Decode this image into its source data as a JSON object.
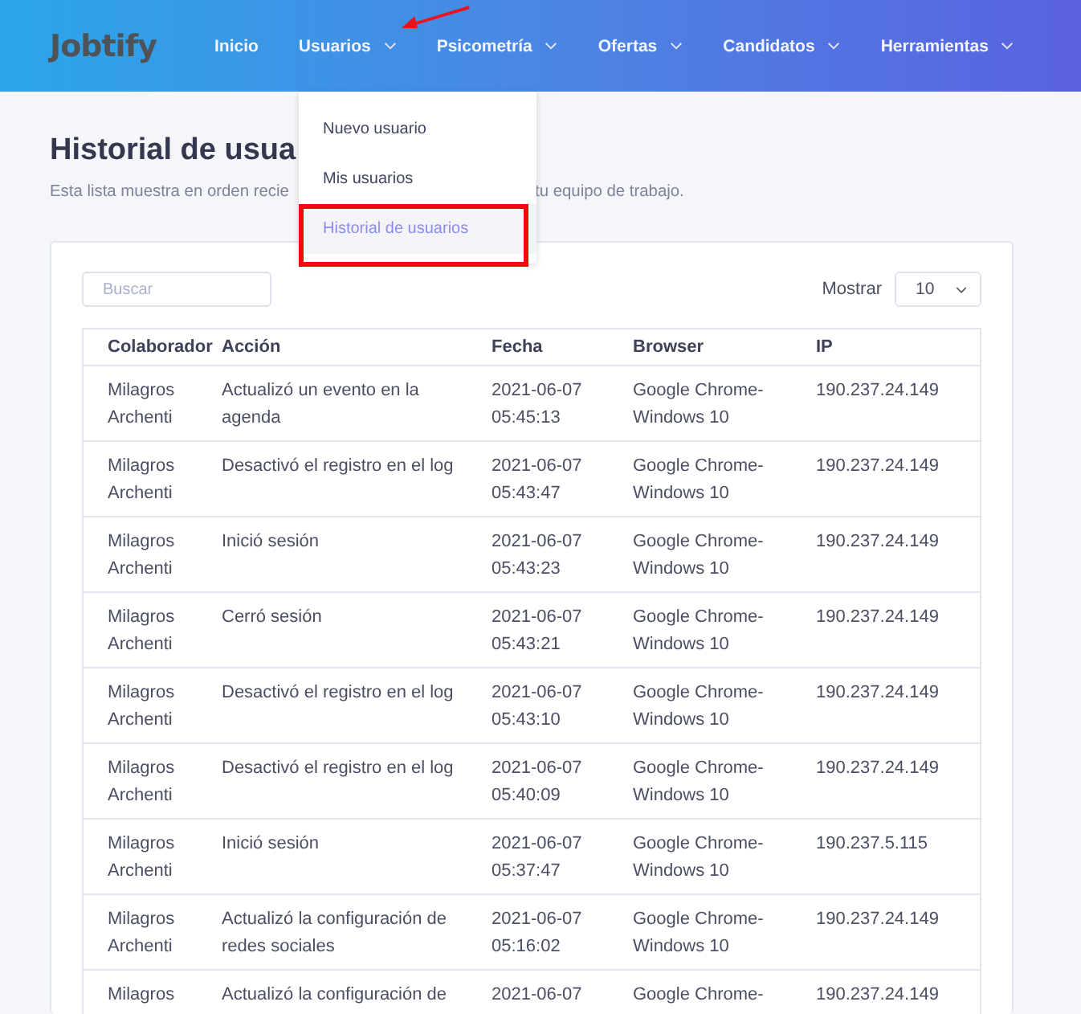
{
  "nav": {
    "logo": "Jobtify",
    "items": [
      {
        "label": "Inicio",
        "dropdown": false
      },
      {
        "label": "Usuarios",
        "dropdown": true
      },
      {
        "label": "Psicometría",
        "dropdown": true
      },
      {
        "label": "Ofertas",
        "dropdown": true
      },
      {
        "label": "Candidatos",
        "dropdown": true
      },
      {
        "label": "Herramientas",
        "dropdown": true
      }
    ]
  },
  "menu": {
    "items": [
      {
        "label": "Nuevo usuario",
        "selected": false,
        "highlighted": false
      },
      {
        "label": "Mis usuarios",
        "selected": false,
        "highlighted": false
      },
      {
        "label": "Historial de usuarios",
        "selected": true,
        "highlighted": true
      }
    ]
  },
  "page": {
    "title": "Historial de usua",
    "subtitle_start": "Esta lista muestra en orden recie",
    "subtitle_end": "tu equipo de trabajo."
  },
  "search": {
    "placeholder": "Buscar"
  },
  "show": {
    "label": "Mostrar",
    "value": "10"
  },
  "table": {
    "columns": [
      "Colaborador",
      "Acción",
      "Fecha",
      "Browser",
      "IP"
    ],
    "rows": [
      [
        "Milagros Archenti",
        "Actualizó un evento en la agenda",
        "2021-06-07 05:45:13",
        "Google Chrome-Windows 10",
        "190.237.24.149"
      ],
      [
        "Milagros Archenti",
        "Desactivó el registro en el log",
        "2021-06-07 05:43:47",
        "Google Chrome-Windows 10",
        "190.237.24.149"
      ],
      [
        "Milagros Archenti",
        "Inició sesión",
        "2021-06-07 05:43:23",
        "Google Chrome-Windows 10",
        "190.237.24.149"
      ],
      [
        "Milagros Archenti",
        "Cerró sesión",
        "2021-06-07 05:43:21",
        "Google Chrome-Windows 10",
        "190.237.24.149"
      ],
      [
        "Milagros Archenti",
        "Desactivó el registro en el log",
        "2021-06-07 05:43:10",
        "Google Chrome-Windows 10",
        "190.237.24.149"
      ],
      [
        "Milagros Archenti",
        "Desactivó el registro en el log",
        "2021-06-07 05:40:09",
        "Google Chrome-Windows 10",
        "190.237.24.149"
      ],
      [
        "Milagros Archenti",
        "Inició sesión",
        "2021-06-07 05:37:47",
        "Google Chrome-Windows 10",
        "190.237.5.115"
      ],
      [
        "Milagros Archenti",
        "Actualizó la configuración de redes sociales",
        "2021-06-07 05:16:02",
        "Google Chrome-Windows 10",
        "190.237.24.149"
      ],
      [
        "Milagros",
        "Actualizó la configuración de",
        "2021-06-07",
        "Google Chrome-",
        "190.237.24.149"
      ]
    ]
  }
}
